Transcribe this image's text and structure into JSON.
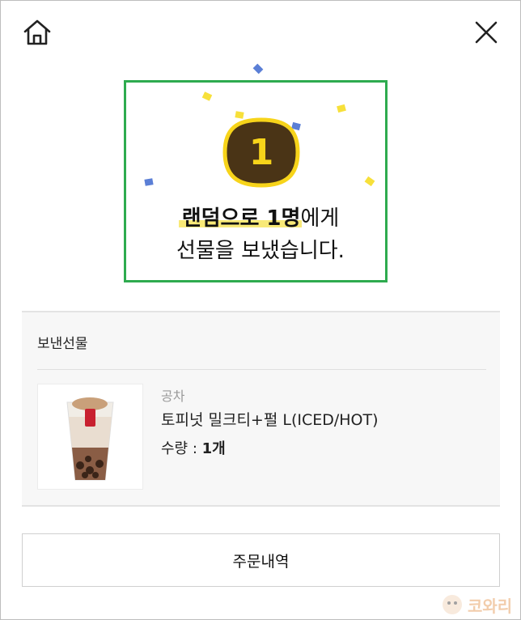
{
  "header": {
    "home_icon": "home-icon",
    "close_icon": "close-icon"
  },
  "result": {
    "badge_number": "1",
    "line1_highlight": "랜덤으로 1명",
    "line1_rest": "에게",
    "line2": "선물을 보냈습니다."
  },
  "sent_gift": {
    "section_title": "보낸선물",
    "brand": "공차",
    "product_name": "토피넛 밀크티+펄 L(ICED/HOT)",
    "qty_label": "수량 : ",
    "qty_value": "1개"
  },
  "footer": {
    "order_history_label": "주문내역"
  },
  "watermark": {
    "text": "코와리"
  },
  "colors": {
    "highlight_border": "#2eab4f",
    "badge_bg": "#4a3416",
    "badge_outline": "#f7d41a",
    "confetti_blue": "#5b7fd6",
    "confetti_yellow": "#f7e03a"
  }
}
